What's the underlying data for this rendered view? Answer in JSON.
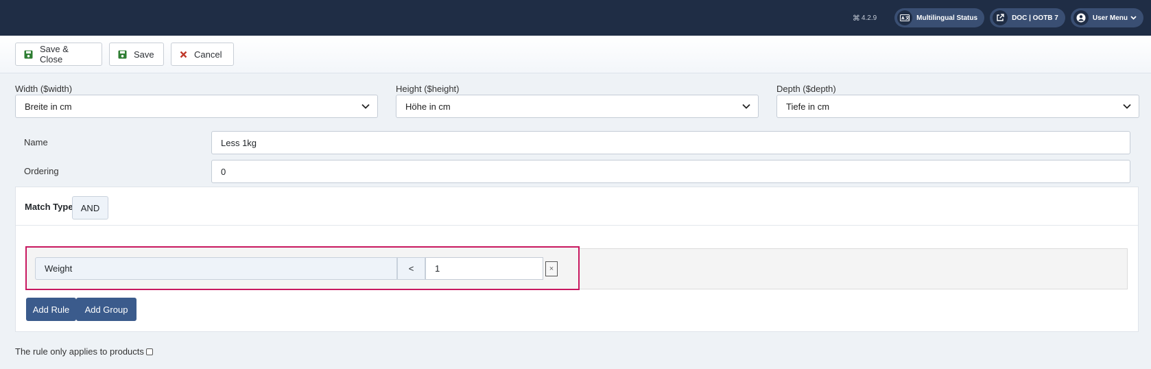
{
  "header": {
    "version": "4.2.9",
    "multilingual": "Multilingual Status",
    "site": "DOC | OOTB 7",
    "user_menu": "User Menu",
    "colors": {
      "background": "#1f2d45",
      "pill": "#3a4f73"
    }
  },
  "toolbar": {
    "save_close": "Save & Close",
    "save": "Save",
    "cancel": "Cancel",
    "colors": {
      "save_icon": "#2e7d32",
      "cancel_icon": "#c0392b"
    }
  },
  "dimensions": {
    "width": {
      "label": "Width ($width)",
      "value": "Breite in cm"
    },
    "height": {
      "label": "Height ($height)",
      "value": "Höhe in cm"
    },
    "depth": {
      "label": "Depth ($depth)",
      "value": "Tiefe in cm"
    }
  },
  "form": {
    "name_label": "Name",
    "name_value": "Less 1kg",
    "ordering_label": "Ordering",
    "ordering_value": "0"
  },
  "query_builder": {
    "match_type_label": "Match Type",
    "match_type_value": "AND",
    "rule": {
      "field": "Weight",
      "operator": "<",
      "value": "1",
      "delete": "×"
    },
    "add_rule": "Add Rule",
    "add_group": "Add Group",
    "colors": {
      "highlight": "#c8175f",
      "button": "#3b5b8c"
    }
  },
  "footer": {
    "products_only": "The rule only applies to products"
  }
}
